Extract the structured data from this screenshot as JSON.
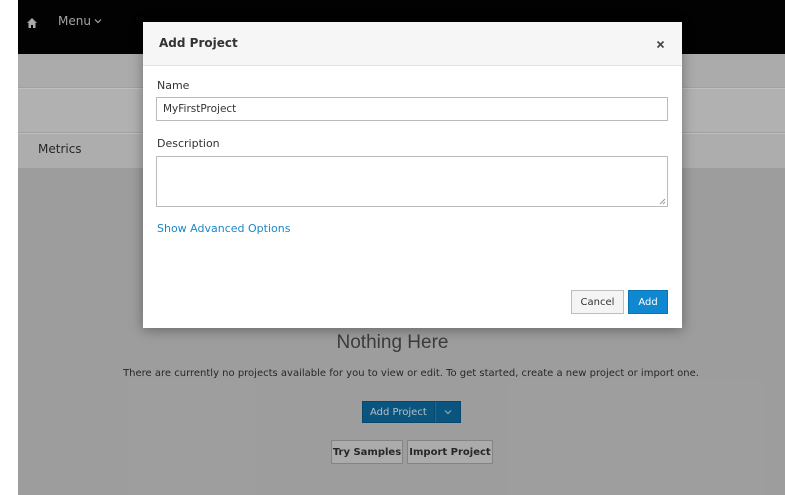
{
  "topbar": {
    "menu_label": "Menu"
  },
  "tabs": {
    "metrics_label": "Metrics"
  },
  "empty_state": {
    "title": "Nothing Here",
    "message": "There are currently no projects available for you to view or edit. To get started, create a new project or import one.",
    "add_project_label": "Add Project",
    "try_samples_label": "Try Samples",
    "import_project_label": "Import Project"
  },
  "modal": {
    "title": "Add Project",
    "name_label": "Name",
    "name_value": "MyFirstProject",
    "description_label": "Description",
    "description_value": "",
    "advanced_link": "Show Advanced Options",
    "cancel_label": "Cancel",
    "add_label": "Add"
  },
  "colors": {
    "topbar": "#030303",
    "primary": "#0f88d1",
    "link": "#1b87c8"
  }
}
